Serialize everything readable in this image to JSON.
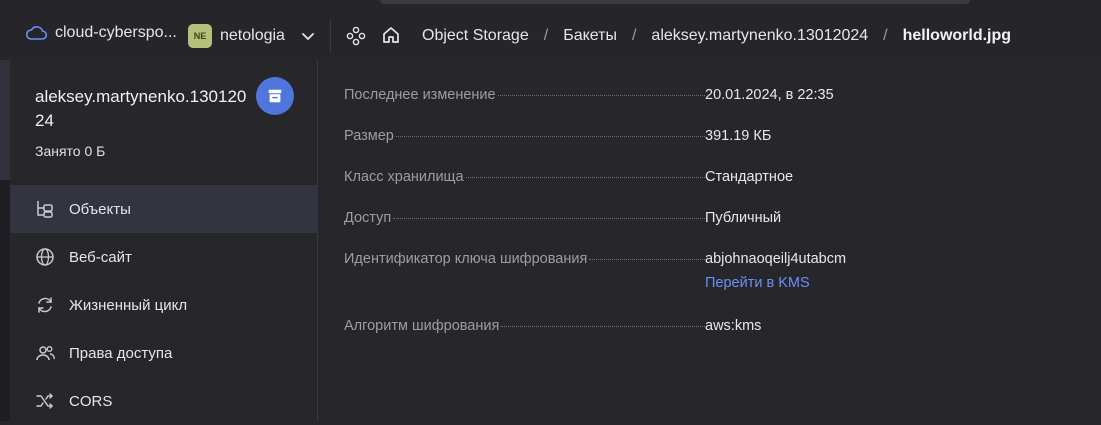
{
  "header": {
    "cloud_label": "cloud-cyberspo...",
    "folder_badge": "NE",
    "folder_label": "netologia",
    "breadcrumbs": [
      "Object Storage",
      "Бакеты",
      "aleksey.martynenko.13012024",
      "helloworld.jpg"
    ]
  },
  "sidebar": {
    "bucket_name": "aleksey.martynenko.13012024",
    "used": "Занято 0 Б",
    "items": [
      {
        "label": "Объекты"
      },
      {
        "label": "Веб-сайт"
      },
      {
        "label": "Жизненный цикл"
      },
      {
        "label": "Права доступа"
      },
      {
        "label": "CORS"
      }
    ]
  },
  "details": {
    "rows": [
      {
        "key": "Последнее изменение",
        "value": "20.01.2024, в 22:35"
      },
      {
        "key": "Размер",
        "value": "391.19 КБ"
      },
      {
        "key": "Класс хранилища",
        "value": "Стандартное"
      },
      {
        "key": "Доступ",
        "value": "Публичный"
      },
      {
        "key": "Идентификатор ключа шифрования",
        "value": "abjohnaoqeilj4utabcm",
        "link": "Перейти в KMS"
      },
      {
        "key": "Алгоритм шифрования",
        "value": "aws:kms"
      }
    ]
  },
  "colors": {
    "accent": "#5176db",
    "link": "#6a8ff7",
    "badge": "#b6c07a"
  }
}
